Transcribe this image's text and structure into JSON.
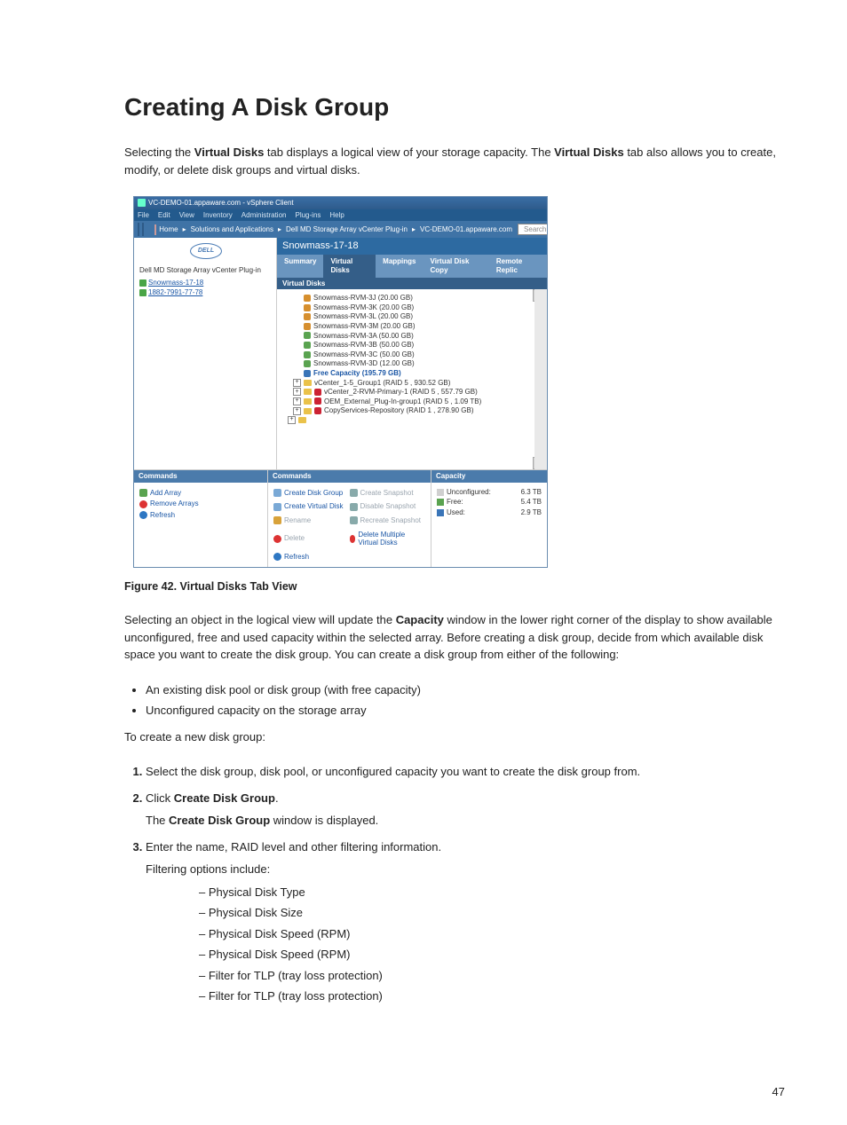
{
  "heading": "Creating A Disk Group",
  "intro": {
    "part1": "Selecting the ",
    "bold1": "Virtual Disks",
    "part2": " tab displays a logical view of your storage capacity. The ",
    "bold2": "Virtual Disks",
    "part3": " tab also allows you to create, modify, or delete disk groups and virtual disks."
  },
  "screenshot": {
    "title": "VC-DEMO-01.appaware.com - vSphere Client",
    "menu": [
      "File",
      "Edit",
      "View",
      "Inventory",
      "Administration",
      "Plug-ins",
      "Help"
    ],
    "breadcrumb": {
      "home": "Home",
      "sol": "Solutions and Applications",
      "plugin": "Dell MD Storage Array vCenter Plug-in",
      "host": "VC-DEMO-01.appaware.com",
      "search": "Search"
    },
    "left_pane": {
      "logo": "DELL",
      "header": "Dell MD Storage Array vCenter Plug-in",
      "items": [
        "Snowmass-17-18",
        "1882-7991-77-78"
      ]
    },
    "array_title": "Snowmass-17-18",
    "tabs": [
      "Summary",
      "Virtual Disks",
      "Mappings",
      "Virtual Disk Copy",
      "Remote Replic"
    ],
    "active_tab": 1,
    "vd_header": "Virtual Disks",
    "tree": [
      "Snowmass-RVM-3J (20.00 GB)",
      "Snowmass-RVM-3K (20.00 GB)",
      "Snowmass-RVM-3L (20.00 GB)",
      "Snowmass-RVM-3M (20.00 GB)",
      "Snowmass-RVM-3A (50.00 GB)",
      "Snowmass-RVM-3B (50.00 GB)",
      "Snowmass-RVM-3C (50.00 GB)",
      "Snowmass-RVM-3D (12.00 GB)"
    ],
    "free_cap": "Free Capacity (195.79 GB)",
    "groups": [
      "vCenter_1-5_Group1 (RAID 5 , 930.52 GB)",
      "vCenter_2-RVM-Primary-1 (RAID 5 , 557.79 GB)",
      "OEM_External_Plug-In-group1 (RAID 5 , 1.09 TB)",
      "CopyServices-Repository (RAID 1 , 278.90 GB)"
    ],
    "commands_left": {
      "header": "Commands",
      "items": [
        "Add Array",
        "Remove Arrays",
        "Refresh"
      ]
    },
    "commands_mid": {
      "header": "Commands",
      "rows": [
        [
          "Create Disk Group",
          "Create Snapshot"
        ],
        [
          "Create Virtual Disk",
          "Disable Snapshot"
        ],
        [
          "Rename",
          "Recreate Snapshot"
        ],
        [
          "Delete",
          "Delete Multiple Virtual Disks"
        ],
        [
          "Refresh",
          ""
        ]
      ]
    },
    "capacity": {
      "header": "Capacity",
      "rows": [
        {
          "label": "Unconfigured:",
          "value": "6.3 TB",
          "color": "#d0d0d0"
        },
        {
          "label": "Free:",
          "value": "5.4 TB",
          "color": "#5aa350"
        },
        {
          "label": "Used:",
          "value": "2.9 TB",
          "color": "#3a75b8"
        }
      ]
    }
  },
  "figure_caption": "Figure 42. Virtual Disks Tab View",
  "para2": {
    "part1": "Selecting an object in the logical view will update the ",
    "bold1": "Capacity",
    "part2": " window in the lower right corner of the display to show available unconfigured, free and used capacity within the selected array. Before creating a disk group, decide from which available disk space you want to create the disk group. You can create a disk group from either of the following:"
  },
  "bullets": [
    "An existing disk pool or disk group (with free capacity)",
    "Unconfigured capacity on the storage array"
  ],
  "para3": "To create a new disk group:",
  "steps": {
    "s1": "Select the disk group, disk pool, or unconfigured capacity you want to create the disk group from.",
    "s2": {
      "part1": "Click ",
      "bold1": "Create Disk Group",
      "part2": ".",
      "line2a": "The ",
      "line2b": "Create Disk Group",
      "line2c": " window is displayed."
    },
    "s3": {
      "line1": "Enter the name, RAID level and other filtering information.",
      "line2": "Filtering options include:",
      "dashes": [
        "Physical Disk Type",
        "Physical Disk Size",
        "Physical Disk Speed (RPM)",
        "Physical Disk Speed (RPM)",
        "Filter for TLP (tray loss protection)",
        "Filter for TLP (tray loss protection)"
      ]
    }
  },
  "page_number": "47"
}
